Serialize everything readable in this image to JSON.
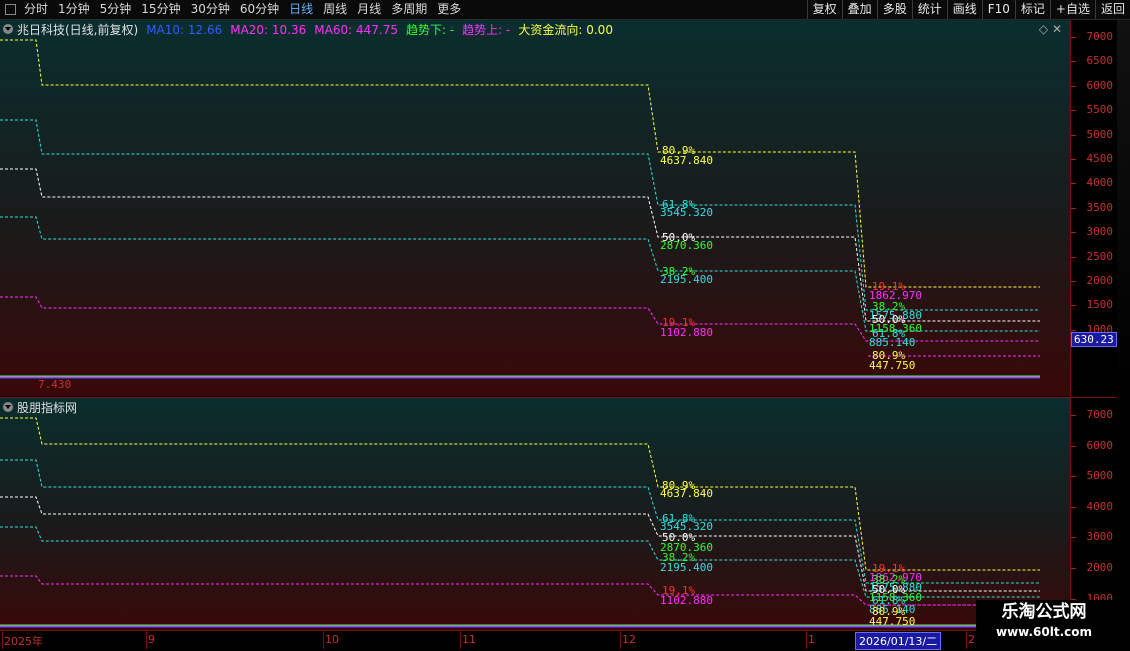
{
  "topbar": {
    "tabs": [
      "分时",
      "1分钟",
      "5分钟",
      "15分钟",
      "30分钟",
      "60分钟",
      "日线",
      "周线",
      "月线",
      "多周期",
      "更多"
    ],
    "active_tab": "日线",
    "right_buttons": [
      "复权",
      "叠加",
      "多股",
      "统计",
      "画线",
      "F10",
      "标记",
      "+自选",
      "返回"
    ]
  },
  "main": {
    "title": "兆日科技(日线,前复权)",
    "indicators": [
      {
        "label": "MA10: 12.66",
        "color": "#2f5bff"
      },
      {
        "label": "MA20: 10.36",
        "color": "#ff30ff"
      },
      {
        "label": "MA60: 447.75",
        "color": "#ff30ff"
      },
      {
        "label": "趋势下: -",
        "color": "#30ff30"
      },
      {
        "label": "趋势上: -",
        "color": "#ff30ff"
      },
      {
        "label": "大资金流向: 0.00",
        "color": "#ffff40"
      }
    ],
    "yaxis": [
      "7000",
      "6500",
      "6000",
      "5500",
      "5000",
      "4500",
      "4000",
      "3500",
      "3000",
      "2500",
      "2000",
      "1500",
      "1000"
    ],
    "current_price": "630.23",
    "bottom_value": "7.430"
  },
  "sub": {
    "title": "股朋指标网",
    "yaxis": [
      "7000",
      "6000",
      "5000",
      "4000",
      "3000",
      "2000",
      "1000"
    ]
  },
  "fib_labels_a": [
    {
      "pct": "80.9%",
      "val": "4637.840",
      "pc": "#ffff40",
      "vc": "#ffff40"
    },
    {
      "pct": "61.8%",
      "val": "3545.320",
      "pc": "#30e0e0",
      "vc": "#30e0e0"
    },
    {
      "pct": "50.0%",
      "val": "2870.360",
      "pc": "#ffffff",
      "vc": "#30ff30"
    },
    {
      "pct": "38.2%",
      "val": "2195.400",
      "pc": "#30ff30",
      "vc": "#30e0e0"
    },
    {
      "pct": "19.1%",
      "val": "1102.880",
      "pc": "#ff3030",
      "vc": "#ff30ff"
    }
  ],
  "fib_labels_b": [
    {
      "pct": "19.1%",
      "val": "1862.970",
      "pc": "#ff3030",
      "vc": "#ff30ff"
    },
    {
      "pct": "38.2%",
      "val": "1575.880",
      "pc": "#30ff30",
      "vc": "#30e0e0"
    },
    {
      "pct": "50.0%",
      "val": "1158.360",
      "pc": "#ffffff",
      "vc": "#30ff30"
    },
    {
      "pct": "61.8%",
      "val": "885.140",
      "pc": "#30e0e0",
      "vc": "#30e0e0"
    },
    {
      "pct": "80.9%",
      "val": "447.750",
      "pc": "#ffff40",
      "vc": "#ffff40"
    }
  ],
  "xaxis": {
    "labels": [
      "2025年",
      "9",
      "10",
      "11",
      "12",
      "1",
      "2"
    ],
    "selected_date": "2026/01/13/二"
  },
  "brand": {
    "line1": "乐淘公式网",
    "line2": "www.60lt.com"
  },
  "colors": {
    "accent": "#5ab4ff",
    "axis": "#c83030",
    "border": "#7a1010"
  }
}
